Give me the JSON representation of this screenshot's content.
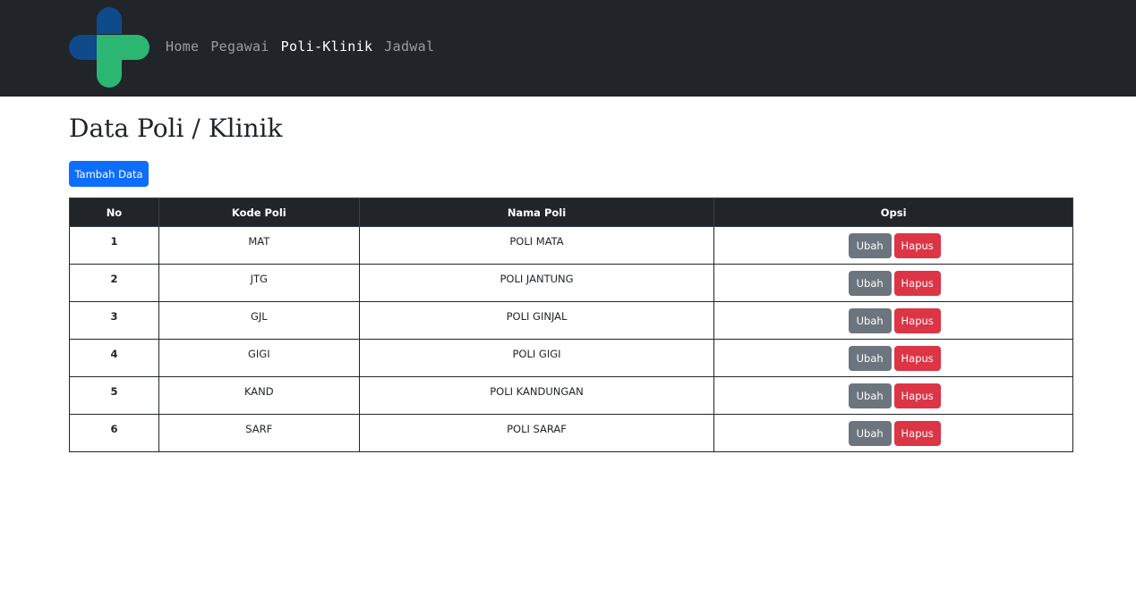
{
  "nav": {
    "links": [
      {
        "label": "Home",
        "active": false
      },
      {
        "label": "Pegawai",
        "active": false
      },
      {
        "label": "Poli-Klinik",
        "active": true
      },
      {
        "label": "Jadwal",
        "active": false
      }
    ]
  },
  "logo": {
    "icon": "medical-cross-icon",
    "colors": {
      "blue": "#0f4a8a",
      "green": "#2bb673"
    }
  },
  "page": {
    "title": "Data Poli / Klinik",
    "add_button_label": "Tambah Data"
  },
  "table": {
    "headers": [
      "No",
      "Kode Poli",
      "Nama Poli",
      "Opsi"
    ],
    "rows": [
      {
        "no": "1",
        "kode": "MAT",
        "nama": "POLI MATA"
      },
      {
        "no": "2",
        "kode": "JTG",
        "nama": "POLI JANTUNG"
      },
      {
        "no": "3",
        "kode": "GJL",
        "nama": "POLI GINJAL"
      },
      {
        "no": "4",
        "kode": "GIGI",
        "nama": "POLI GIGI"
      },
      {
        "no": "5",
        "kode": "KAND",
        "nama": "POLI KANDUNGAN"
      },
      {
        "no": "6",
        "kode": "SARF",
        "nama": "POLI SARAF"
      }
    ],
    "edit_label": "Ubah",
    "delete_label": "Hapus"
  },
  "colors": {
    "navbar_bg": "#212529",
    "primary": "#0d6efd",
    "secondary": "#6c757d",
    "danger": "#dc3545"
  }
}
